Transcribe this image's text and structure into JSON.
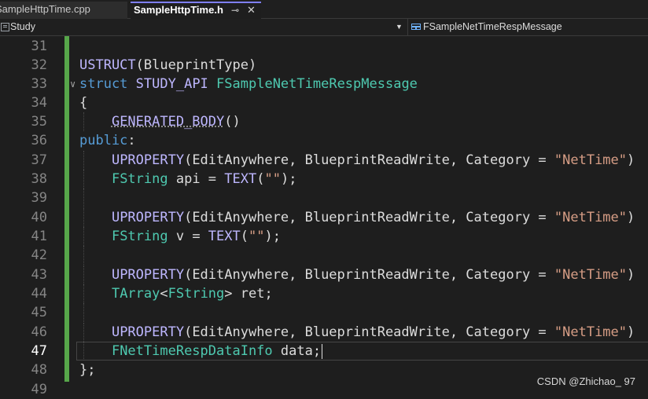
{
  "tabs": [
    {
      "label": "SampleHttpTime.cpp",
      "active": false
    },
    {
      "label": "SampleHttpTime.h",
      "active": true,
      "pin_icon": "pin-icon",
      "close_icon": "close-icon"
    }
  ],
  "nav": {
    "project": "Study",
    "scope": "FSampleNetTimeRespMessage"
  },
  "lines": [
    {
      "n": "31"
    },
    {
      "n": "32"
    },
    {
      "n": "33"
    },
    {
      "n": "34"
    },
    {
      "n": "35"
    },
    {
      "n": "36"
    },
    {
      "n": "37"
    },
    {
      "n": "38"
    },
    {
      "n": "39"
    },
    {
      "n": "40"
    },
    {
      "n": "41"
    },
    {
      "n": "42"
    },
    {
      "n": "43"
    },
    {
      "n": "44"
    },
    {
      "n": "45"
    },
    {
      "n": "46"
    },
    {
      "n": "47"
    },
    {
      "n": "48"
    },
    {
      "n": "49"
    }
  ],
  "code": {
    "l32": {
      "macro": "USTRUCT",
      "args": "(BlueprintType)"
    },
    "l33": {
      "kw": "struct",
      "api": "STUDY_API",
      "name": "FSampleNetTimeRespMessage"
    },
    "l34": "{",
    "l35": {
      "macro": "GENERATED_BODY",
      "args": "()"
    },
    "l36": {
      "kw": "public",
      "punct": ":"
    },
    "uprop": {
      "macro": "UPROPERTY",
      "args_pre": "(EditAnywhere, BlueprintReadWrite, Category = ",
      "str": "\"NetTime\"",
      "close": ")"
    },
    "l38": {
      "type": "FString",
      "rest1": " api = ",
      "macro": "TEXT",
      "open": "(",
      "str": "\"\"",
      "close": ");"
    },
    "l41": {
      "type": "FString",
      "rest1": " v = ",
      "macro": "TEXT",
      "open": "(",
      "str": "\"\"",
      "close": ");"
    },
    "l44": {
      "type": "TArray",
      "lt": "<",
      "inner": "FString",
      "gt": ">",
      "rest": " ret;"
    },
    "l47": {
      "type": "FNetTimeRespDataInfo",
      "rest": " data;"
    },
    "l48": "};"
  },
  "current_line": "47",
  "watermark": "CSDN @Zhichao_ 97",
  "colors": {
    "background": "#1e1e1e",
    "keyword": "#569cd6",
    "macro": "#beb7ff",
    "type": "#4ec9b0",
    "string": "#d69d85",
    "change_bar": "#57a64a"
  }
}
